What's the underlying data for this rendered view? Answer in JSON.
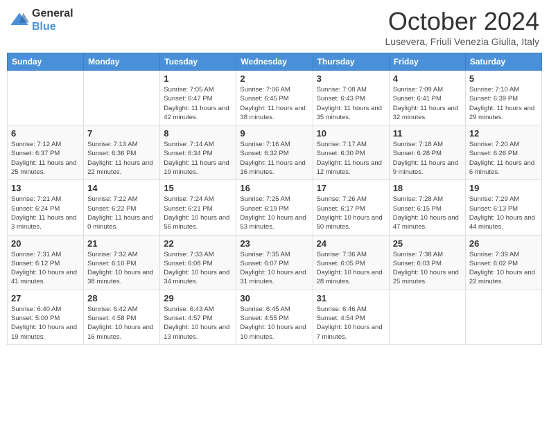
{
  "header": {
    "logo": {
      "general": "General",
      "blue": "Blue"
    },
    "month": "October 2024",
    "location": "Lusevera, Friuli Venezia Giulia, Italy"
  },
  "days_of_week": [
    "Sunday",
    "Monday",
    "Tuesday",
    "Wednesday",
    "Thursday",
    "Friday",
    "Saturday"
  ],
  "weeks": [
    [
      {
        "day": "",
        "info": ""
      },
      {
        "day": "",
        "info": ""
      },
      {
        "day": "1",
        "info": "Sunrise: 7:05 AM\nSunset: 6:47 PM\nDaylight: 11 hours and 42 minutes."
      },
      {
        "day": "2",
        "info": "Sunrise: 7:06 AM\nSunset: 6:45 PM\nDaylight: 11 hours and 38 minutes."
      },
      {
        "day": "3",
        "info": "Sunrise: 7:08 AM\nSunset: 6:43 PM\nDaylight: 11 hours and 35 minutes."
      },
      {
        "day": "4",
        "info": "Sunrise: 7:09 AM\nSunset: 6:41 PM\nDaylight: 11 hours and 32 minutes."
      },
      {
        "day": "5",
        "info": "Sunrise: 7:10 AM\nSunset: 6:39 PM\nDaylight: 11 hours and 29 minutes."
      }
    ],
    [
      {
        "day": "6",
        "info": "Sunrise: 7:12 AM\nSunset: 6:37 PM\nDaylight: 11 hours and 25 minutes."
      },
      {
        "day": "7",
        "info": "Sunrise: 7:13 AM\nSunset: 6:36 PM\nDaylight: 11 hours and 22 minutes."
      },
      {
        "day": "8",
        "info": "Sunrise: 7:14 AM\nSunset: 6:34 PM\nDaylight: 11 hours and 19 minutes."
      },
      {
        "day": "9",
        "info": "Sunrise: 7:16 AM\nSunset: 6:32 PM\nDaylight: 11 hours and 16 minutes."
      },
      {
        "day": "10",
        "info": "Sunrise: 7:17 AM\nSunset: 6:30 PM\nDaylight: 11 hours and 12 minutes."
      },
      {
        "day": "11",
        "info": "Sunrise: 7:18 AM\nSunset: 6:28 PM\nDaylight: 11 hours and 9 minutes."
      },
      {
        "day": "12",
        "info": "Sunrise: 7:20 AM\nSunset: 6:26 PM\nDaylight: 11 hours and 6 minutes."
      }
    ],
    [
      {
        "day": "13",
        "info": "Sunrise: 7:21 AM\nSunset: 6:24 PM\nDaylight: 11 hours and 3 minutes."
      },
      {
        "day": "14",
        "info": "Sunrise: 7:22 AM\nSunset: 6:22 PM\nDaylight: 11 hours and 0 minutes."
      },
      {
        "day": "15",
        "info": "Sunrise: 7:24 AM\nSunset: 6:21 PM\nDaylight: 10 hours and 56 minutes."
      },
      {
        "day": "16",
        "info": "Sunrise: 7:25 AM\nSunset: 6:19 PM\nDaylight: 10 hours and 53 minutes."
      },
      {
        "day": "17",
        "info": "Sunrise: 7:26 AM\nSunset: 6:17 PM\nDaylight: 10 hours and 50 minutes."
      },
      {
        "day": "18",
        "info": "Sunrise: 7:28 AM\nSunset: 6:15 PM\nDaylight: 10 hours and 47 minutes."
      },
      {
        "day": "19",
        "info": "Sunrise: 7:29 AM\nSunset: 6:13 PM\nDaylight: 10 hours and 44 minutes."
      }
    ],
    [
      {
        "day": "20",
        "info": "Sunrise: 7:31 AM\nSunset: 6:12 PM\nDaylight: 10 hours and 41 minutes."
      },
      {
        "day": "21",
        "info": "Sunrise: 7:32 AM\nSunset: 6:10 PM\nDaylight: 10 hours and 38 minutes."
      },
      {
        "day": "22",
        "info": "Sunrise: 7:33 AM\nSunset: 6:08 PM\nDaylight: 10 hours and 34 minutes."
      },
      {
        "day": "23",
        "info": "Sunrise: 7:35 AM\nSunset: 6:07 PM\nDaylight: 10 hours and 31 minutes."
      },
      {
        "day": "24",
        "info": "Sunrise: 7:36 AM\nSunset: 6:05 PM\nDaylight: 10 hours and 28 minutes."
      },
      {
        "day": "25",
        "info": "Sunrise: 7:38 AM\nSunset: 6:03 PM\nDaylight: 10 hours and 25 minutes."
      },
      {
        "day": "26",
        "info": "Sunrise: 7:39 AM\nSunset: 6:02 PM\nDaylight: 10 hours and 22 minutes."
      }
    ],
    [
      {
        "day": "27",
        "info": "Sunrise: 6:40 AM\nSunset: 5:00 PM\nDaylight: 10 hours and 19 minutes."
      },
      {
        "day": "28",
        "info": "Sunrise: 6:42 AM\nSunset: 4:58 PM\nDaylight: 10 hours and 16 minutes."
      },
      {
        "day": "29",
        "info": "Sunrise: 6:43 AM\nSunset: 4:57 PM\nDaylight: 10 hours and 13 minutes."
      },
      {
        "day": "30",
        "info": "Sunrise: 6:45 AM\nSunset: 4:55 PM\nDaylight: 10 hours and 10 minutes."
      },
      {
        "day": "31",
        "info": "Sunrise: 6:46 AM\nSunset: 4:54 PM\nDaylight: 10 hours and 7 minutes."
      },
      {
        "day": "",
        "info": ""
      },
      {
        "day": "",
        "info": ""
      }
    ]
  ]
}
